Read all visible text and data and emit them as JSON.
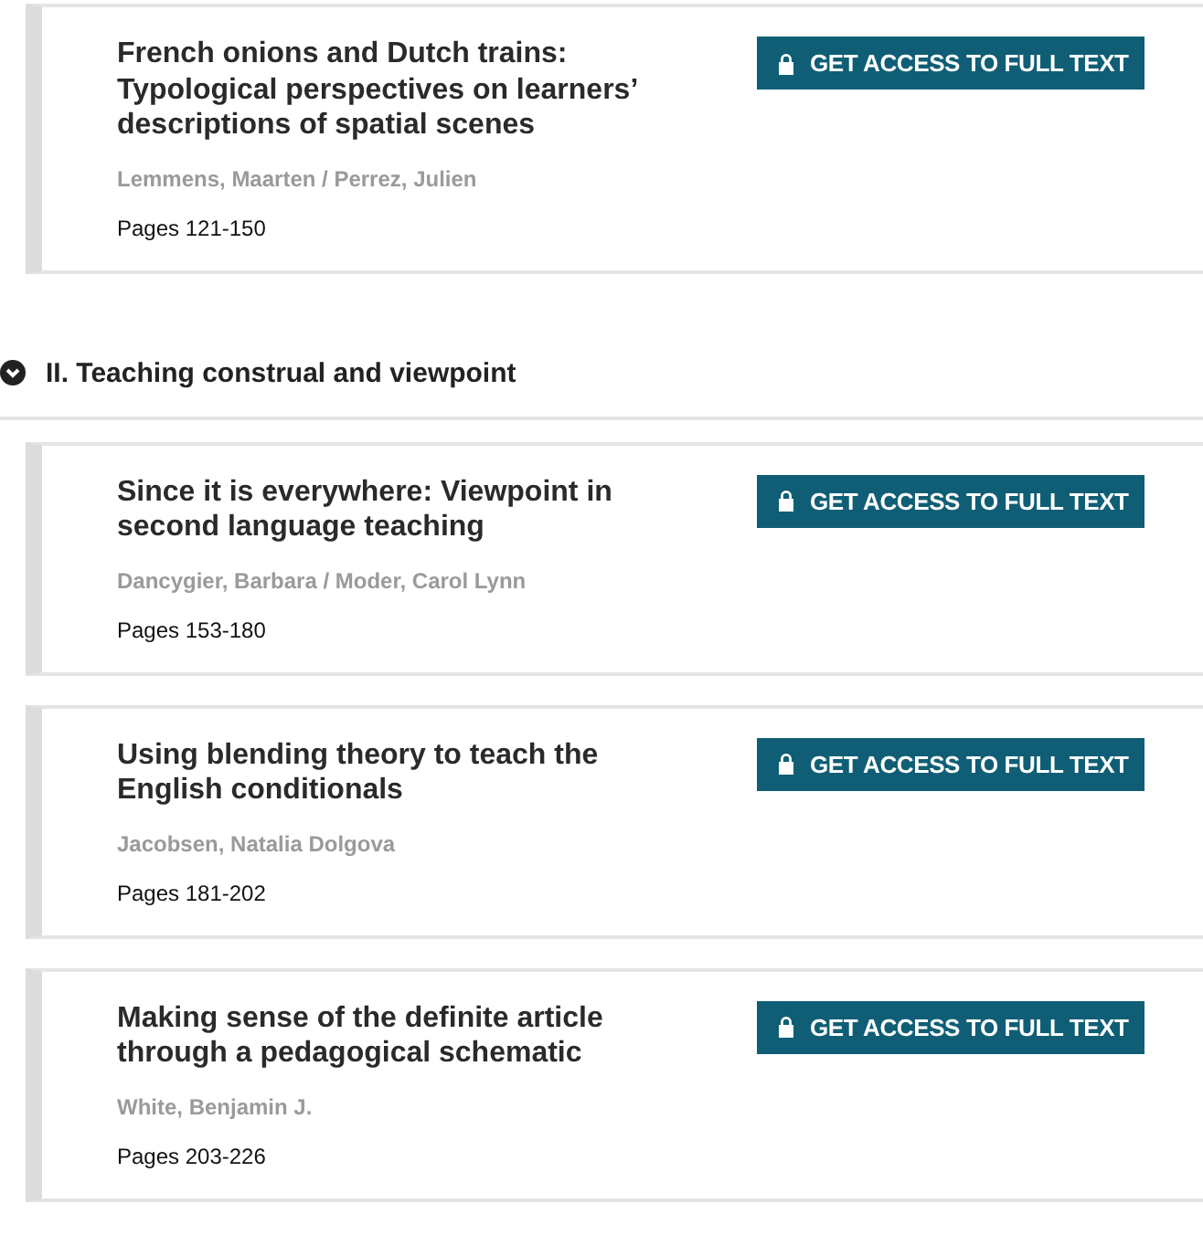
{
  "items": [
    {
      "kind": "chapter",
      "title": "French onions and Dutch trains: Typological perspectives on learners’ descriptions of spatial scenes",
      "authors": "Lemmens, Maarten / Perrez, Julien",
      "pages": "Pages 121-150",
      "button": "GET ACCESS TO FULL TEXT"
    },
    {
      "kind": "section",
      "title": "II. Teaching construal and viewpoint",
      "expanded": true
    },
    {
      "kind": "chapter",
      "title": "Since it is everywhere: Viewpoint in second language teaching",
      "authors": "Dancygier, Barbara / Moder, Carol Lynn",
      "pages": "Pages 153-180",
      "button": "GET ACCESS TO FULL TEXT"
    },
    {
      "kind": "chapter",
      "title": "Using blending theory to teach the English conditionals",
      "authors": "Jacobsen, Natalia Dolgova",
      "pages": "Pages 181-202",
      "button": "GET ACCESS TO FULL TEXT"
    },
    {
      "kind": "chapter",
      "title": "Making sense of the definite article through a pedagogical schematic",
      "authors": "White, Benjamin J.",
      "pages": "Pages 203-226",
      "button": "GET ACCESS TO FULL TEXT"
    }
  ]
}
